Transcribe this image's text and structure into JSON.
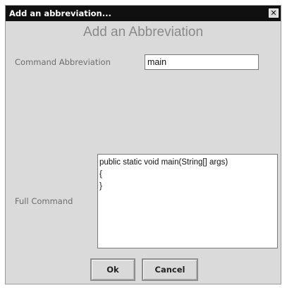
{
  "window": {
    "title": "Add an abbreviation...",
    "close_glyph": "✕"
  },
  "dialog": {
    "heading": "Add an Abbreviation",
    "abbreviation_label": "Command Abbreviation",
    "abbreviation_value": "main",
    "full_command_label": "Full Command",
    "full_command_lines": [
      "public static void main(String[] args)",
      "{",
      "",
      "}"
    ]
  },
  "buttons": {
    "ok_label": "Ok",
    "cancel_label": "Cancel"
  }
}
